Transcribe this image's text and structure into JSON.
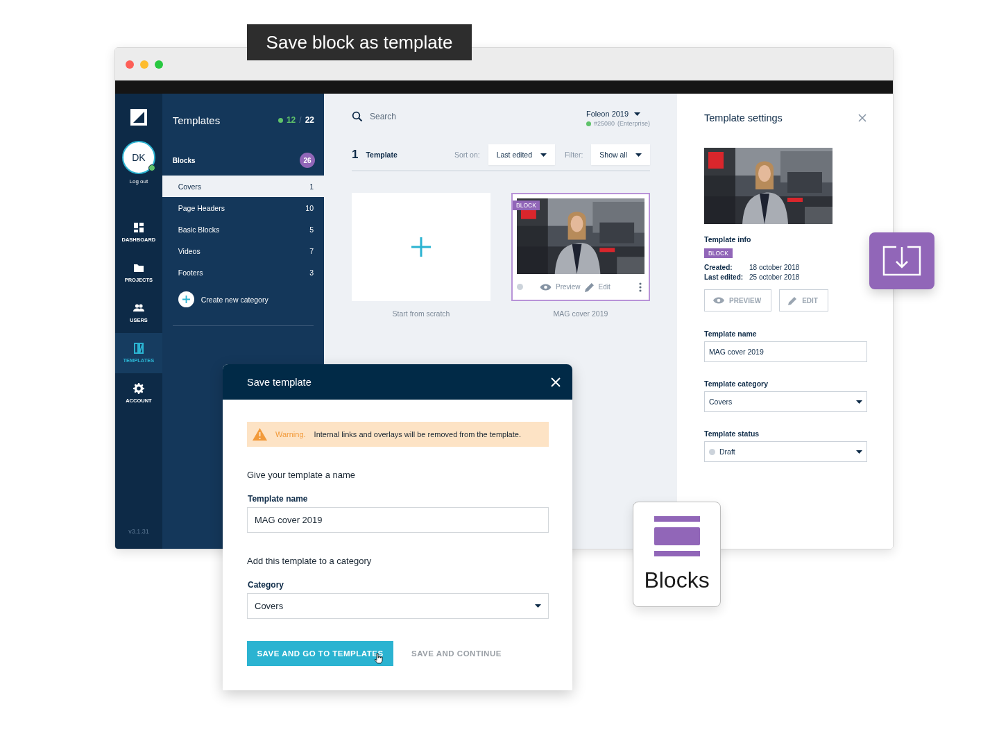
{
  "caption": {
    "text": "Save block as template"
  },
  "rail": {
    "avatar": {
      "initials": "DK",
      "online": true
    },
    "logout": "Log out",
    "version": "v3.1.31",
    "items": [
      {
        "label": "DASHBOARD",
        "selected": false
      },
      {
        "label": "PROJECTS",
        "selected": false
      },
      {
        "label": "USERS",
        "selected": false
      },
      {
        "label": "TEMPLATES",
        "selected": true
      },
      {
        "label": "ACCOUNT",
        "selected": false
      }
    ]
  },
  "panel": {
    "title": "Templates",
    "published": "12",
    "separator": "/",
    "total": "22",
    "group": {
      "label": "Blocks",
      "count": "26"
    },
    "categories": [
      {
        "label": "Covers",
        "count": "1",
        "selected": true
      },
      {
        "label": "Page Headers",
        "count": "10",
        "selected": false
      },
      {
        "label": "Basic Blocks",
        "count": "5",
        "selected": false
      },
      {
        "label": "Videos",
        "count": "7",
        "selected": false
      },
      {
        "label": "Footers",
        "count": "3",
        "selected": false
      }
    ],
    "create": "Create new category"
  },
  "main": {
    "search": {
      "placeholder": "Search"
    },
    "account": {
      "name": "Foleon 2019",
      "id": "#25080",
      "plan": "(Enterprise)",
      "online": true
    },
    "count": "1",
    "count_label": "Template",
    "sort": {
      "label": "Sort on:",
      "value": "Last edited"
    },
    "filter": {
      "label": "Filter:",
      "value": "Show all"
    },
    "cards": [
      {
        "kind": "new",
        "caption": "Start from scratch",
        "selected": false
      },
      {
        "kind": "template",
        "caption": "MAG cover 2019",
        "badge": "BLOCK",
        "selected": true,
        "preview": "Preview",
        "edit": "Edit"
      }
    ]
  },
  "settings": {
    "title": "Template settings",
    "info_heading": "Template info",
    "badge": "BLOCK",
    "created_label": "Created:",
    "created": "18 october 2018",
    "edited_label": "Last edited:",
    "edited": "25 october 2018",
    "preview": "PREVIEW",
    "edit": "EDIT",
    "fields": [
      {
        "kind": "text",
        "label": "Template name",
        "value": "MAG cover 2019"
      },
      {
        "kind": "select",
        "label": "Template category",
        "value": "Covers"
      },
      {
        "kind": "status",
        "label": "Template status",
        "value": "Draft"
      }
    ]
  },
  "modal": {
    "title": "Save template",
    "warning": {
      "label": "Warning.",
      "text": "Internal links and overlays will be removed from the template."
    },
    "name_heading": "Give your template a name",
    "name_label": "Template name",
    "name_value": "MAG cover 2019",
    "category_heading": "Add this template to a category",
    "category_label": "Category",
    "category_value": "Covers",
    "primary": "SAVE AND GO TO TEMPLATES",
    "secondary": "SAVE AND CONTINUE"
  },
  "blocks_tile": {
    "label": "Blocks"
  }
}
